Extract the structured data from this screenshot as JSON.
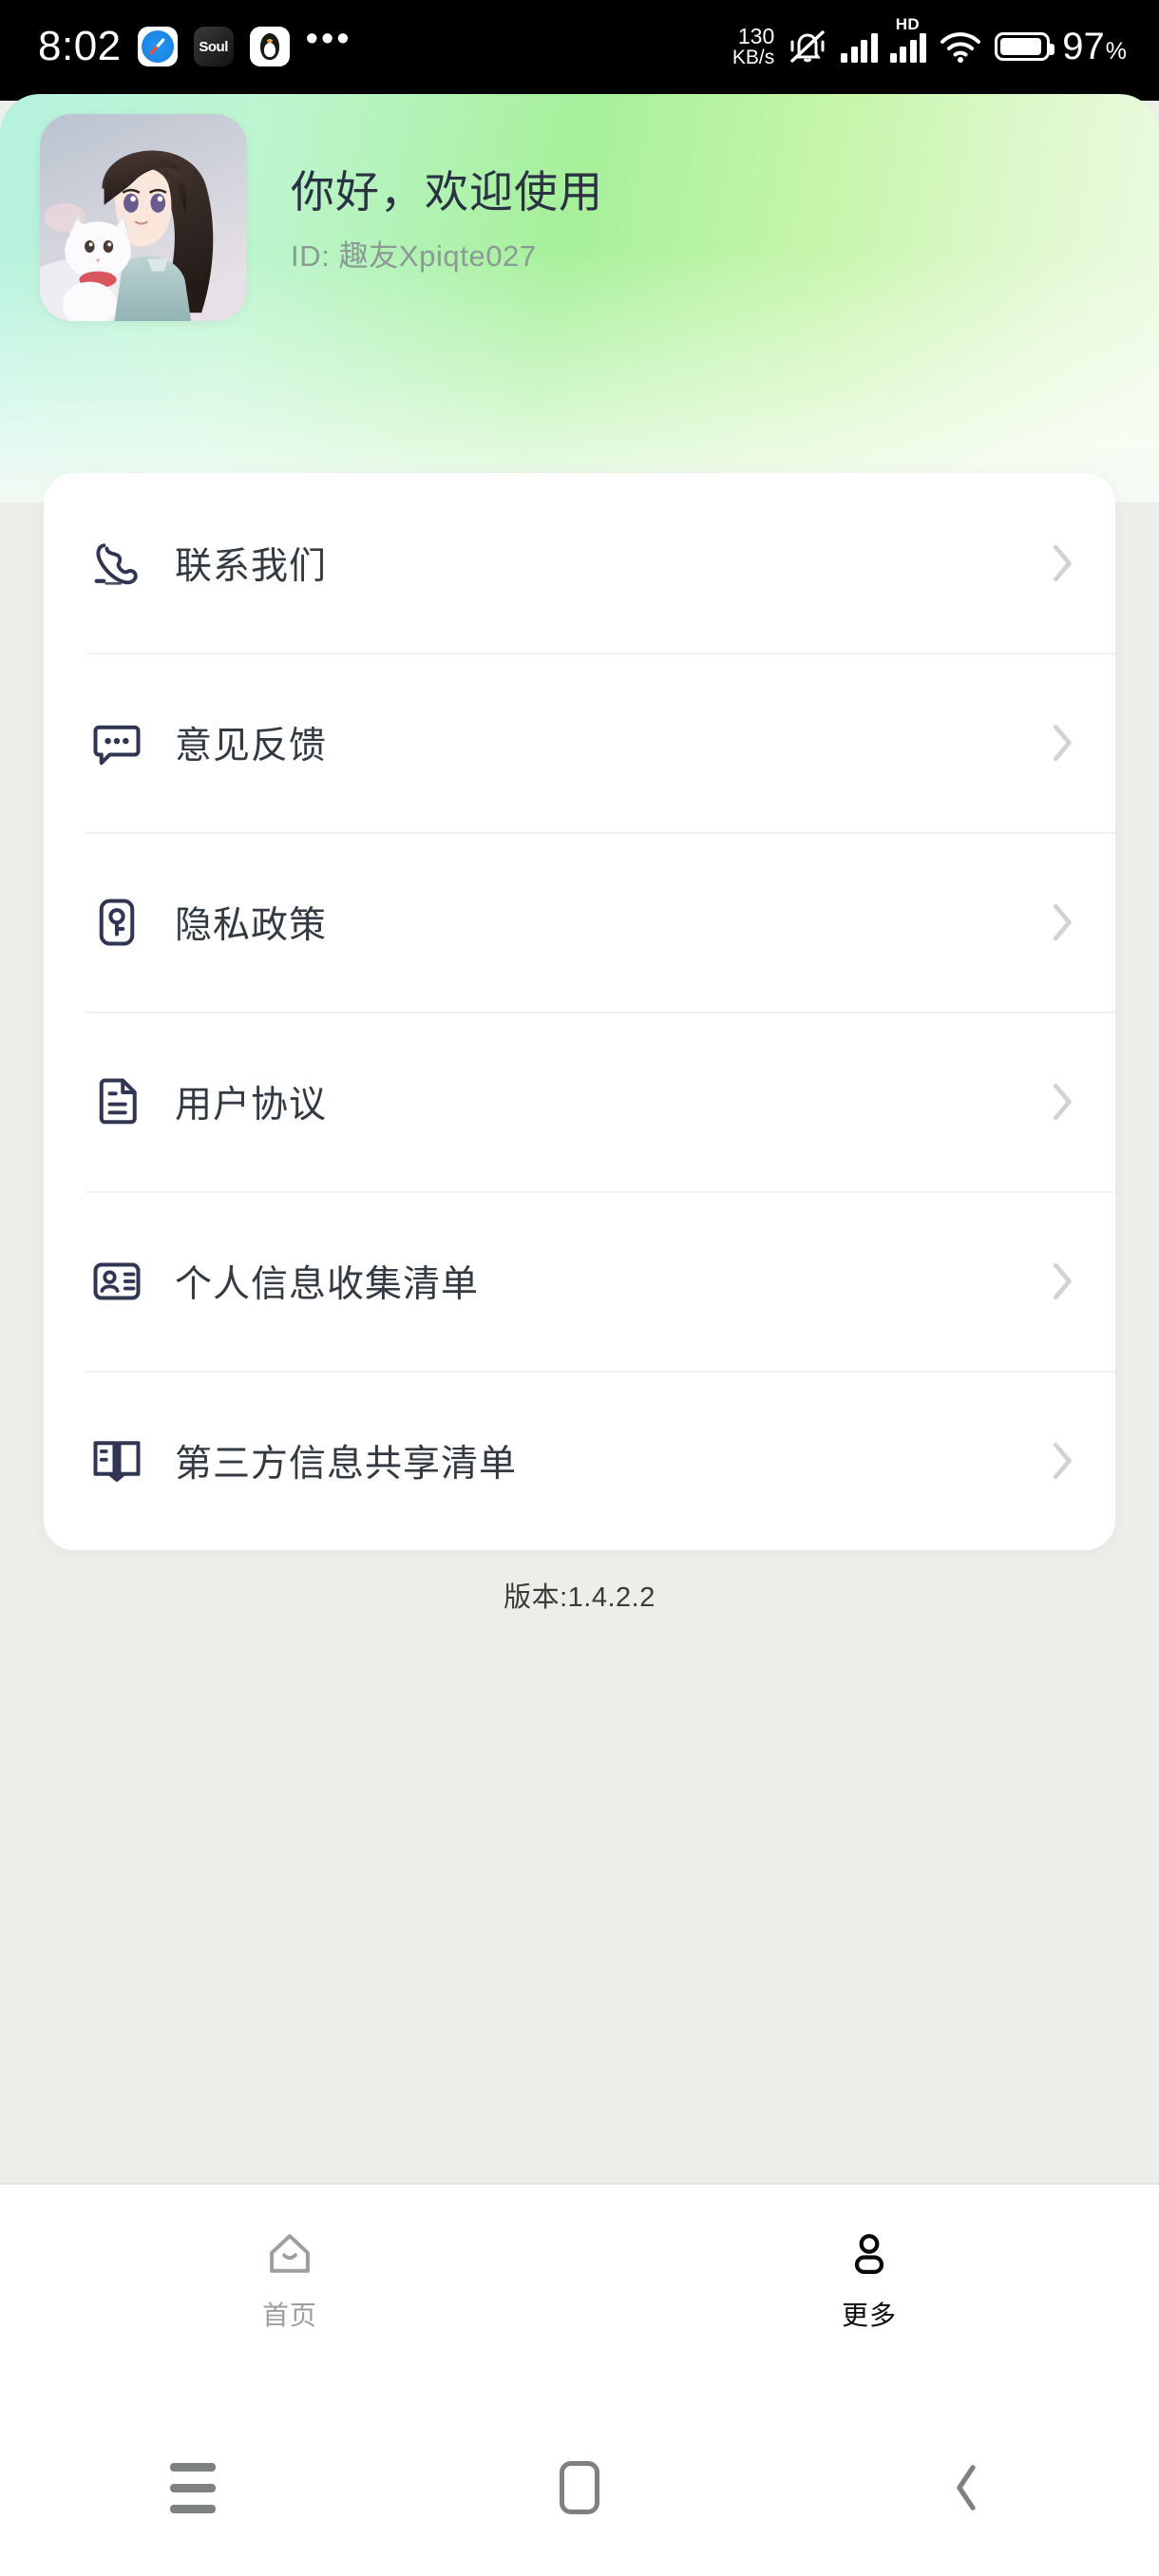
{
  "statusbar": {
    "time": "8:02",
    "overflow_dots": "•••",
    "netspeed_value": "130",
    "netspeed_unit": "KB/s",
    "hd_label": "HD",
    "battery_percent": "97",
    "battery_percent_symbol": "%",
    "app_soul_label": "Soul",
    "icons": [
      "safari-compass-icon",
      "soul-app-icon",
      "qq-penguin-icon",
      "overflow-dots-icon",
      "vibrate-off-icon",
      "signal-bars-icon",
      "signal-bars-hd-icon",
      "wifi-icon",
      "battery-icon"
    ]
  },
  "header": {
    "greeting": "你好，欢迎使用",
    "user_id": "ID: 趣友Xpiqte027",
    "avatar_alt": "anime-girl-with-cat-avatar",
    "gradient_start": "#b6f2df",
    "gradient_mid": "#a7f09a",
    "gradient_end": "#edfbe4"
  },
  "menu": {
    "items": [
      {
        "label": "联系我们",
        "icon": "phone-icon"
      },
      {
        "label": "意见反馈",
        "icon": "chat-bubble-icon"
      },
      {
        "label": "隐私政策",
        "icon": "privacy-key-icon"
      },
      {
        "label": "用户协议",
        "icon": "document-icon"
      },
      {
        "label": "个人信息收集清单",
        "icon": "id-card-icon"
      },
      {
        "label": "第三方信息共享清单",
        "icon": "open-book-icon"
      }
    ],
    "chevron_icon": "chevron-right-icon",
    "icon_color": "#2f3552",
    "chevron_color": "#d0d3d4"
  },
  "version": {
    "text": "版本:1.4.2.2"
  },
  "tabbar": {
    "tabs": [
      {
        "label": "首页",
        "icon": "home-icon",
        "active": false
      },
      {
        "label": "更多",
        "icon": "person-icon",
        "active": true
      }
    ],
    "active_color": "#0a0a0a",
    "inactive_color": "#9aa09a"
  },
  "navbar": {
    "buttons": [
      {
        "name": "recents",
        "icon": "hamburger-icon"
      },
      {
        "name": "home",
        "icon": "square-icon"
      },
      {
        "name": "back",
        "icon": "chevron-left-icon"
      }
    ],
    "color": "#7d8280"
  }
}
